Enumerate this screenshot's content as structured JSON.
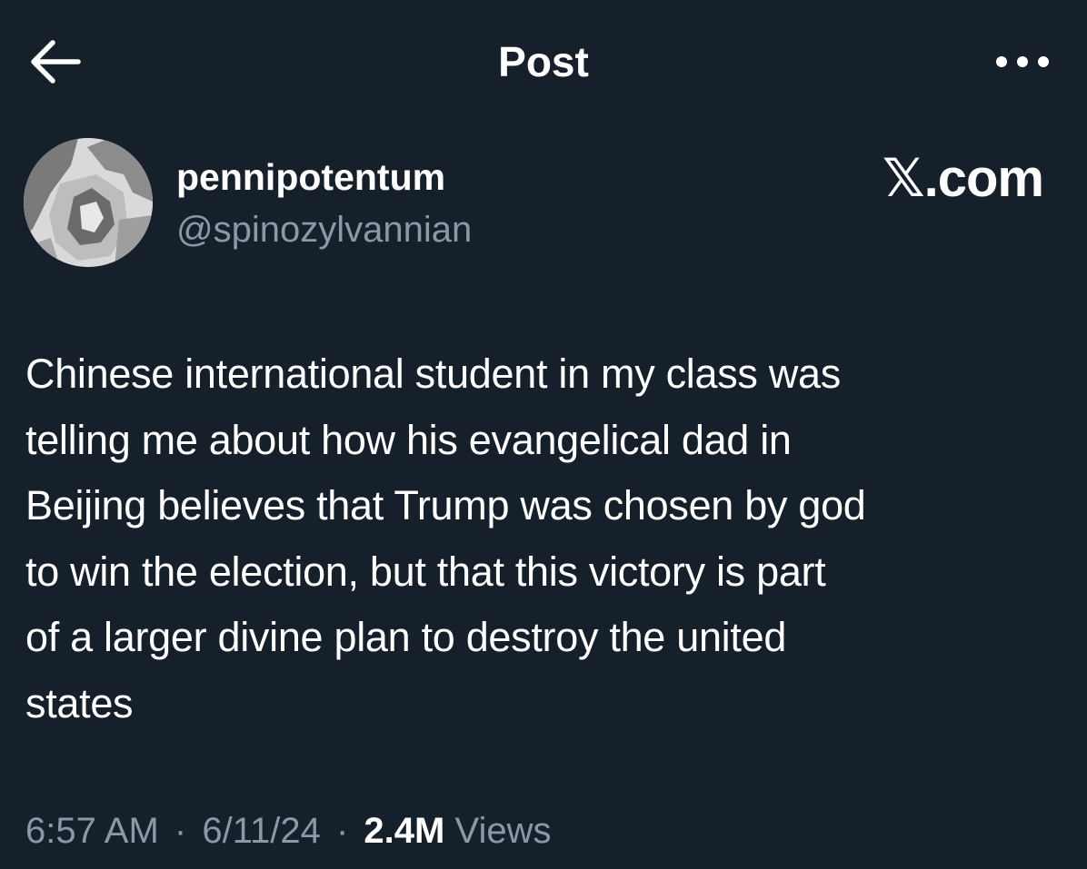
{
  "header": {
    "title": "Post",
    "back_icon": "arrow-left-icon",
    "more_icon": "more-horizontal-icon"
  },
  "author": {
    "display_name": "pennipotentum",
    "handle": "@spinozylvannian",
    "avatar_icon": "avatar-image"
  },
  "source_badge": "𝕏.com",
  "post": {
    "text": "Chinese international student in my class was\ntelling me about how his evangelical dad in\nBeijing believes that Trump was chosen by god\nto win the election, but that this victory is part\nof a larger divine plan to destroy the united\nstates"
  },
  "meta": {
    "time": "6:57 AM",
    "date": "6/11/24",
    "separator": "·",
    "views_count": "2.4M",
    "views_label": "Views"
  },
  "colors": {
    "background": "#15202b",
    "text_primary": "#ffffff",
    "text_secondary": "#8b98a5"
  }
}
